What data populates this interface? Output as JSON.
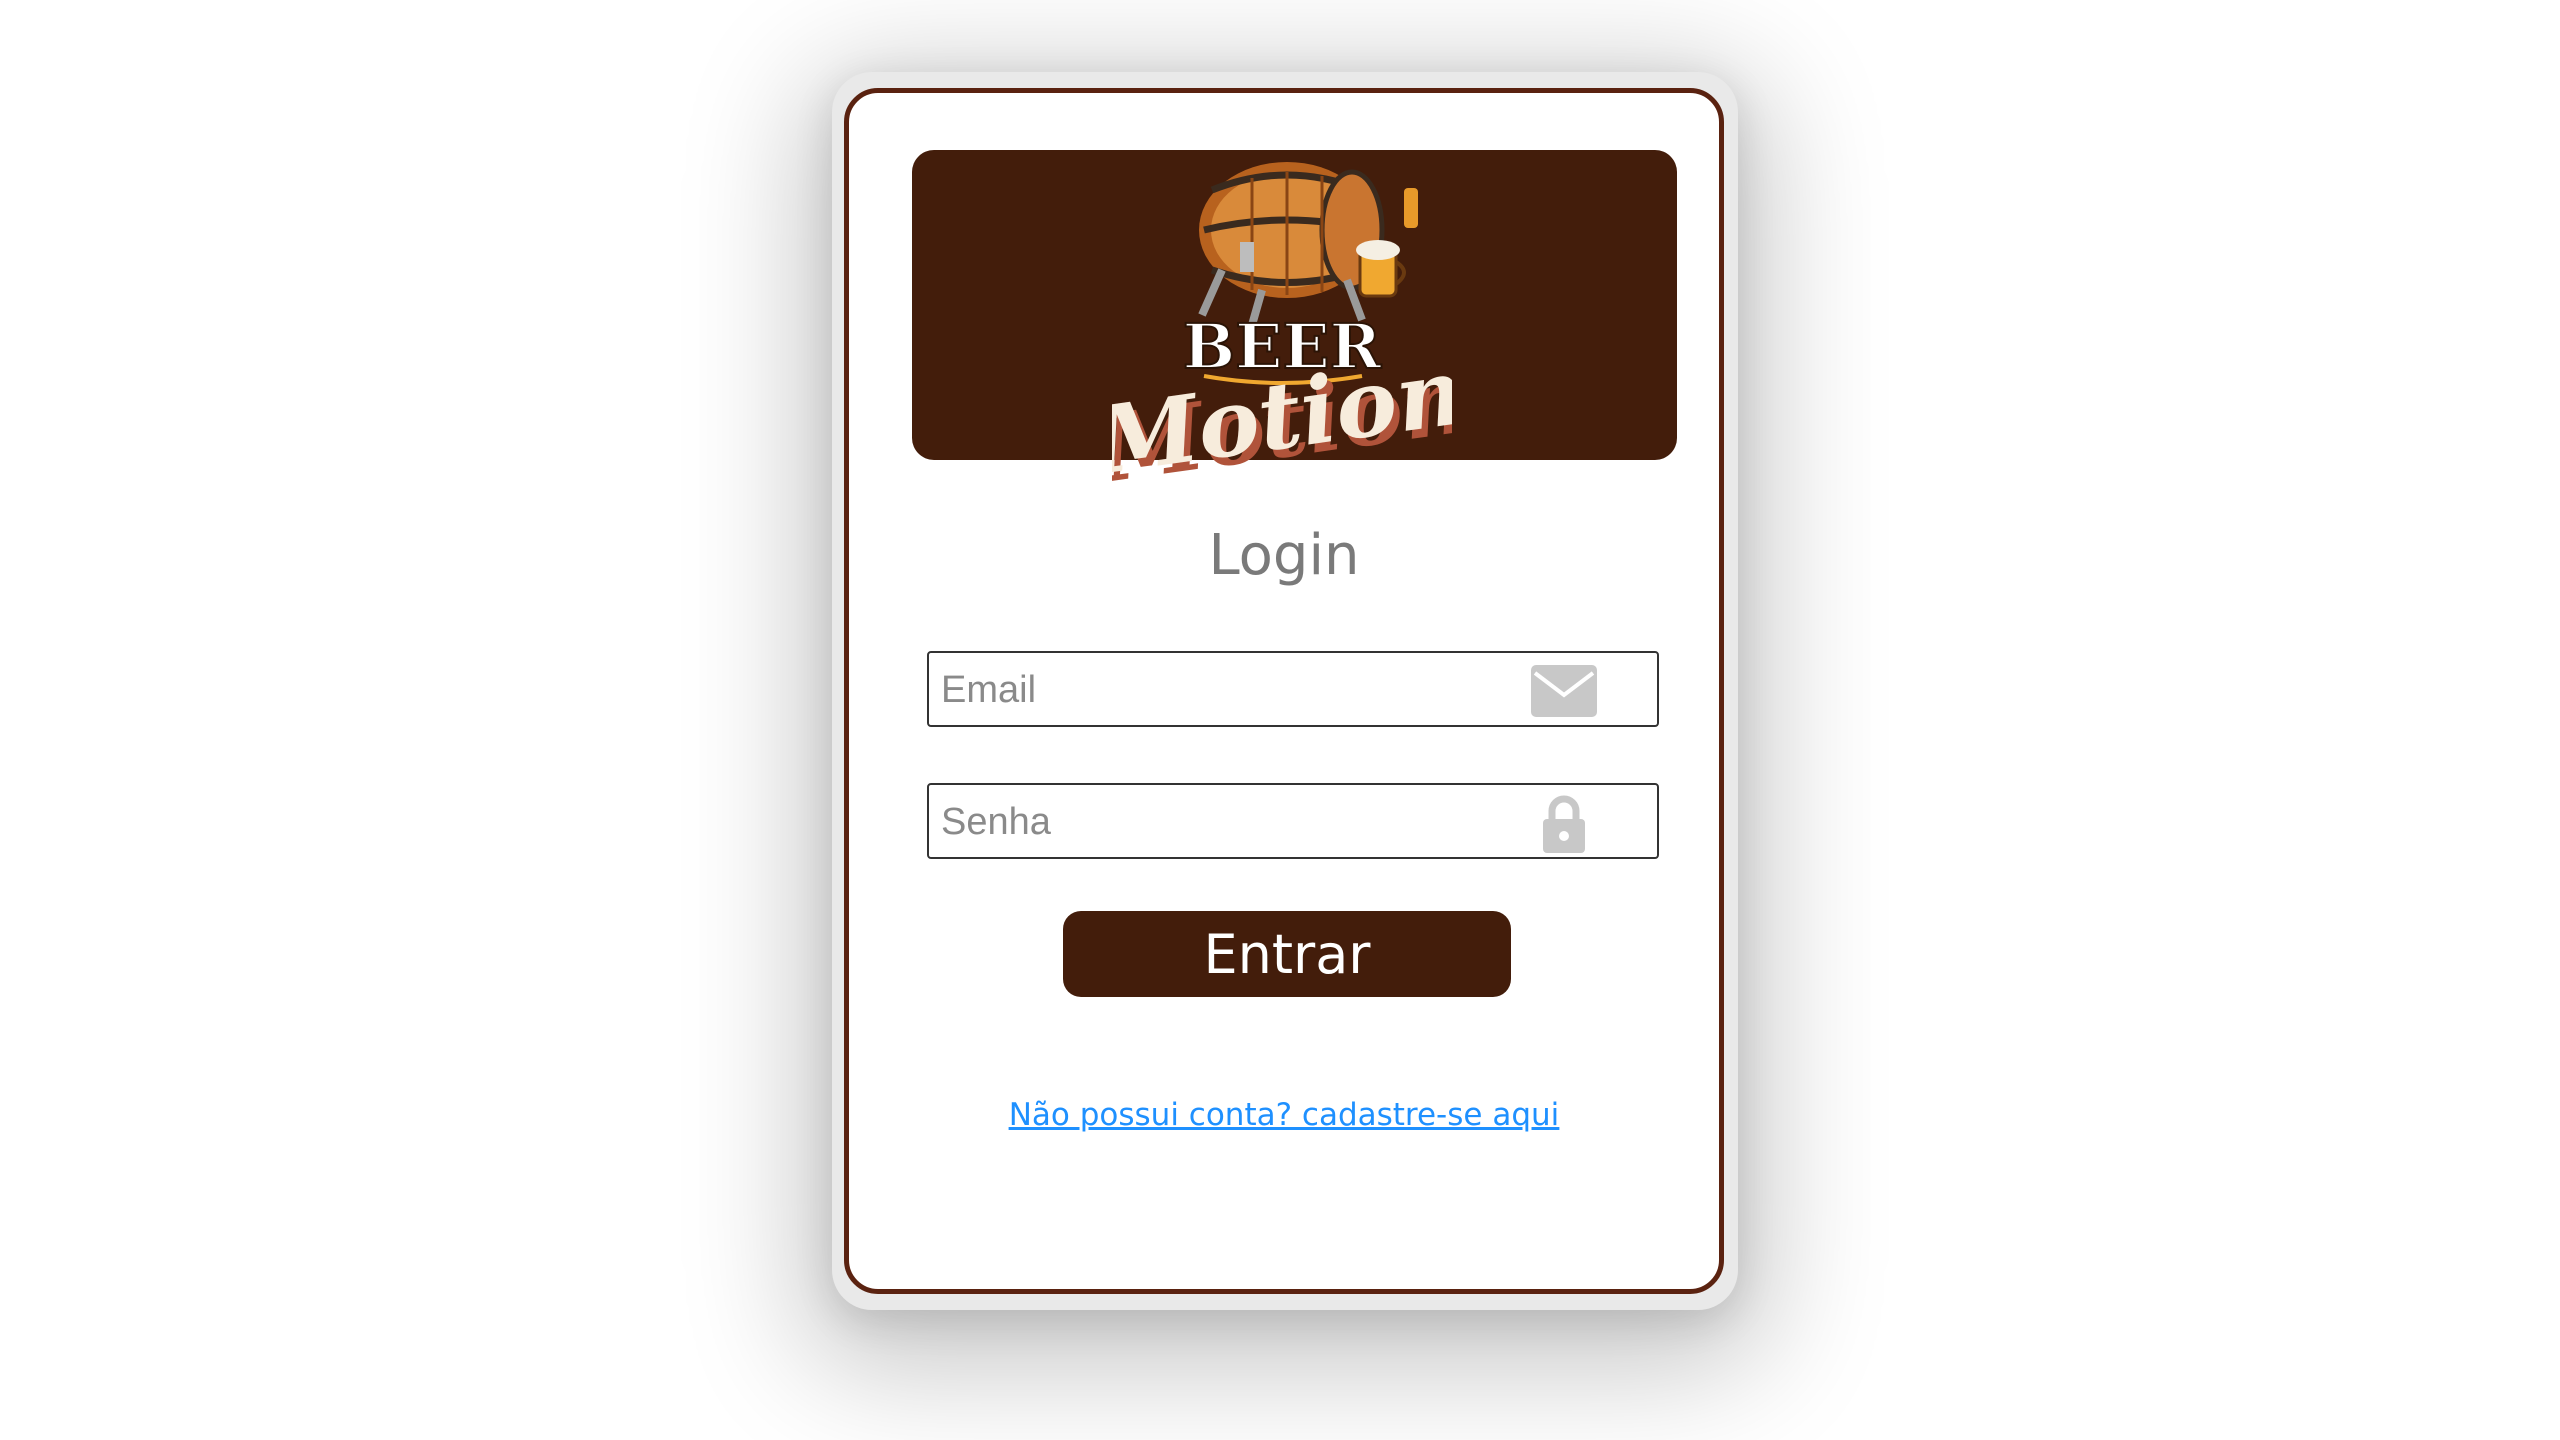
{
  "logo": {
    "brand_line1": "BEER",
    "brand_line2": "Motion"
  },
  "form": {
    "title": "Login",
    "email_placeholder": "Email",
    "email_value": "",
    "password_placeholder": "Senha",
    "password_value": "",
    "submit_label": "Entrar",
    "signup_link_label": "Não possui conta? cadastre-se aqui"
  },
  "icons": {
    "email": "envelope-icon",
    "password": "lock-icon"
  },
  "colors": {
    "brand_dark_brown": "#431d0b",
    "card_border": "#5a2210",
    "link_blue": "#1e90ff",
    "title_gray": "#7a7a7a",
    "icon_gray": "#c8c8c8"
  }
}
